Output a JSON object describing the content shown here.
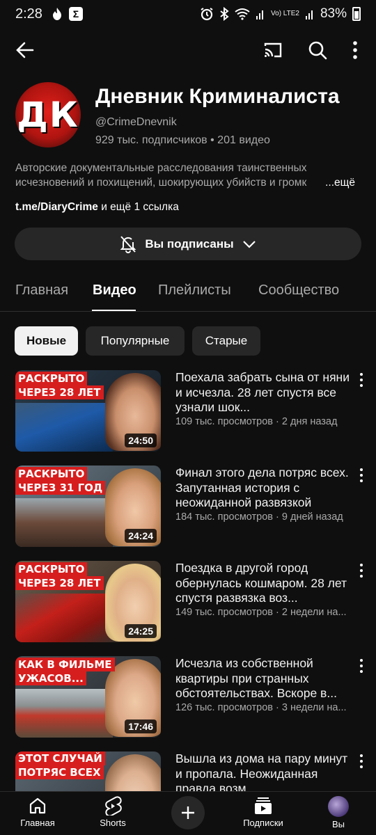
{
  "status_bar": {
    "time": "2:28",
    "battery": "83%",
    "network": "Vo) LTE2"
  },
  "channel": {
    "avatar_text": "ДК",
    "name": "Дневник Криминалиста",
    "handle": "@CrimeDnevnik",
    "stats": "929 тыс. подписчиков • 201 видео",
    "description": "Авторские документальные расследования таинственных исчезновений и похищений, шокирующих убийств и громк",
    "description_more": "...ещё",
    "link_main": "t.me/DiaryCrime",
    "link_more": " и ещё 1 ссылка",
    "subscribe_label": "Вы подписаны"
  },
  "tabs": [
    {
      "label": "Главная"
    },
    {
      "label": "Видео",
      "active": true
    },
    {
      "label": "Плейлисты"
    },
    {
      "label": "Сообщество"
    }
  ],
  "chips": [
    {
      "label": "Новые",
      "active": true
    },
    {
      "label": "Популярные"
    },
    {
      "label": "Старые"
    }
  ],
  "videos": [
    {
      "banner1": "РАСКРЫТО",
      "banner2": "ЧЕРЕЗ 28 ЛЕТ",
      "duration": "24:50",
      "title": "Поехала забрать сына от няни и исчезла. 28 лет спустя все узнали шок...",
      "meta": "109 тыс. просмотров · 2 дня назад"
    },
    {
      "banner1": "РАСКРЫТО",
      "banner2": "ЧЕРЕЗ 31 ГОД",
      "duration": "24:24",
      "title": "Финал этого дела потряс всех. Запутанная история с неожиданной развязкой",
      "meta": "184 тыс. просмотров · 9 дней назад"
    },
    {
      "banner1": "РАСКРЫТО",
      "banner2": "ЧЕРЕЗ 28 ЛЕТ",
      "duration": "24:25",
      "title": "Поездка в другой город обернулась кошмаром. 28 лет спустя развязка воз...",
      "meta": "149 тыс. просмотров · 2 недели на..."
    },
    {
      "banner1": "КАК В ФИЛЬМЕ",
      "banner2": "УЖАСОВ...",
      "duration": "17:46",
      "title": "Исчезла из собственной квартиры при странных обстоятельствах. Вскоре в...",
      "meta": "126 тыс. просмотров · 3 недели на..."
    },
    {
      "banner1": "ЭТОТ СЛУЧАЙ",
      "banner2": "ПОТРЯС ВСЕХ",
      "duration": "",
      "title": "Вышла из дома на пару минут и пропала. Неожиданная правда возм...",
      "meta": ""
    }
  ],
  "bottom_nav": {
    "home": "Главная",
    "shorts": "Shorts",
    "subscriptions": "Подписки",
    "you": "Вы"
  },
  "colors": {
    "background": "#0f0f0f",
    "surface": "#272727",
    "banner_red": "#d71e1e",
    "text_secondary": "#aaaaaa"
  }
}
